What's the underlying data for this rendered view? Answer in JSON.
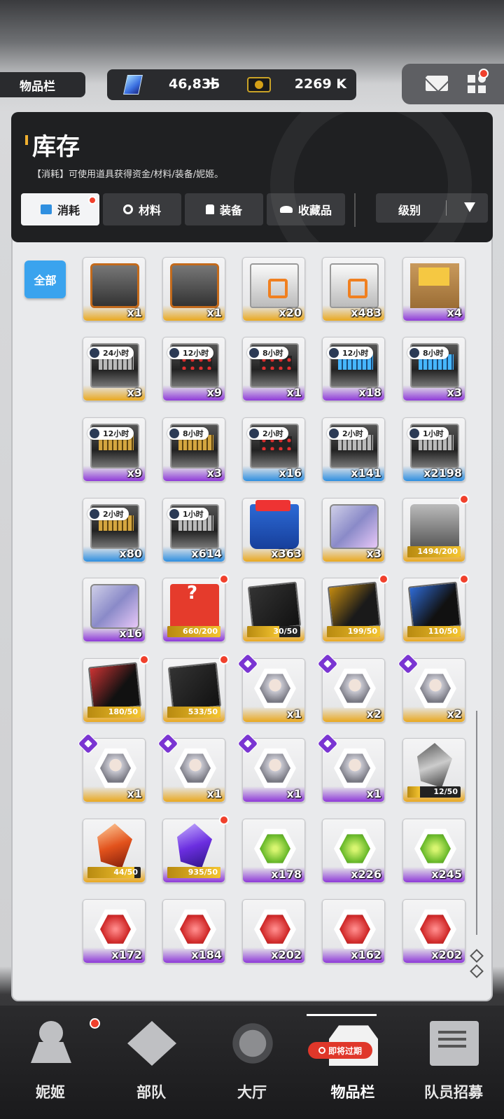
{
  "top": {
    "section_label": "物品栏",
    "gems": "46,835",
    "gems_plus": "+",
    "credits": "2269 K"
  },
  "header": {
    "title": "库存",
    "description": "【消耗】可使用道具获得资金/材料/装备/妮姬。",
    "tabs": [
      {
        "label": "消耗"
      },
      {
        "label": "材料"
      },
      {
        "label": "装备"
      },
      {
        "label": "收藏品"
      }
    ],
    "sort_label": "级别"
  },
  "filter": {
    "all_label": "全部"
  },
  "items": [
    {
      "qty": "x1",
      "rarity": "gold"
    },
    {
      "qty": "x1",
      "rarity": "gold"
    },
    {
      "qty": "x20",
      "rarity": "gold"
    },
    {
      "qty": "x483",
      "rarity": "gold"
    },
    {
      "qty": "x4",
      "rarity": "purple"
    },
    {
      "qty": "x3",
      "rarity": "gold",
      "timer": "24小时"
    },
    {
      "qty": "x9",
      "rarity": "purple",
      "timer": "12小时"
    },
    {
      "qty": "x1",
      "rarity": "purple",
      "timer": "8小时"
    },
    {
      "qty": "x18",
      "rarity": "purple",
      "timer": "12小时"
    },
    {
      "qty": "x3",
      "rarity": "purple",
      "timer": "8小时"
    },
    {
      "qty": "x9",
      "rarity": "purple",
      "timer": "12小时"
    },
    {
      "qty": "x3",
      "rarity": "purple",
      "timer": "8小时"
    },
    {
      "qty": "x16",
      "rarity": "blue",
      "timer": "2小时"
    },
    {
      "qty": "x141",
      "rarity": "blue",
      "timer": "2小时"
    },
    {
      "qty": "x2198",
      "rarity": "blue",
      "timer": "1小时"
    },
    {
      "qty": "x80",
      "rarity": "blue",
      "timer": "2小时"
    },
    {
      "qty": "x614",
      "rarity": "blue",
      "timer": "1小时"
    },
    {
      "qty": "x363",
      "rarity": "gold"
    },
    {
      "qty": "x3",
      "rarity": "gold"
    },
    {
      "progress": "1494/200",
      "fill": 1.0,
      "rarity": "gold"
    },
    {
      "qty": "x16",
      "rarity": "purple"
    },
    {
      "progress": "660/200",
      "fill": 1.0,
      "rarity": "purple"
    },
    {
      "progress": "30/50",
      "fill": 0.6,
      "rarity": "gold"
    },
    {
      "progress": "199/50",
      "fill": 1.0,
      "rarity": "gold"
    },
    {
      "progress": "110/50",
      "fill": 1.0,
      "rarity": "gold"
    },
    {
      "progress": "180/50",
      "fill": 1.0,
      "rarity": "gold"
    },
    {
      "progress": "533/50",
      "fill": 1.0,
      "rarity": "gold"
    },
    {
      "qty": "x1",
      "rarity": "gold"
    },
    {
      "qty": "x2",
      "rarity": "gold"
    },
    {
      "qty": "x2",
      "rarity": "gold"
    },
    {
      "qty": "x1",
      "rarity": "gold"
    },
    {
      "qty": "x1",
      "rarity": "gold"
    },
    {
      "qty": "x1",
      "rarity": "purple"
    },
    {
      "qty": "x1",
      "rarity": "purple"
    },
    {
      "progress": "12/50",
      "fill": 0.24,
      "rarity": "gold"
    },
    {
      "progress": "44/50",
      "fill": 0.88,
      "rarity": "gold"
    },
    {
      "progress": "935/50",
      "fill": 1.0,
      "rarity": "purple"
    },
    {
      "qty": "x178",
      "rarity": "purple"
    },
    {
      "qty": "x226",
      "rarity": "purple"
    },
    {
      "qty": "x245",
      "rarity": "purple"
    },
    {
      "qty": "x172",
      "rarity": "purple"
    },
    {
      "qty": "x184",
      "rarity": "purple"
    },
    {
      "qty": "x202",
      "rarity": "purple"
    },
    {
      "qty": "x162",
      "rarity": "purple"
    },
    {
      "qty": "x202",
      "rarity": "purple"
    }
  ],
  "nav": {
    "items": [
      {
        "label": "妮姬"
      },
      {
        "label": "部队"
      },
      {
        "label": "大厅"
      },
      {
        "label": "物品栏"
      },
      {
        "label": "队员招募"
      }
    ],
    "expire_badge": "即将过期"
  },
  "colors": {
    "accent_blue": "#3aa3ee",
    "badge_red": "#f0402c",
    "rarity_gold": "#e9a820",
    "rarity_purple": "#8e3ad8",
    "rarity_blue": "#2f8fe0"
  }
}
